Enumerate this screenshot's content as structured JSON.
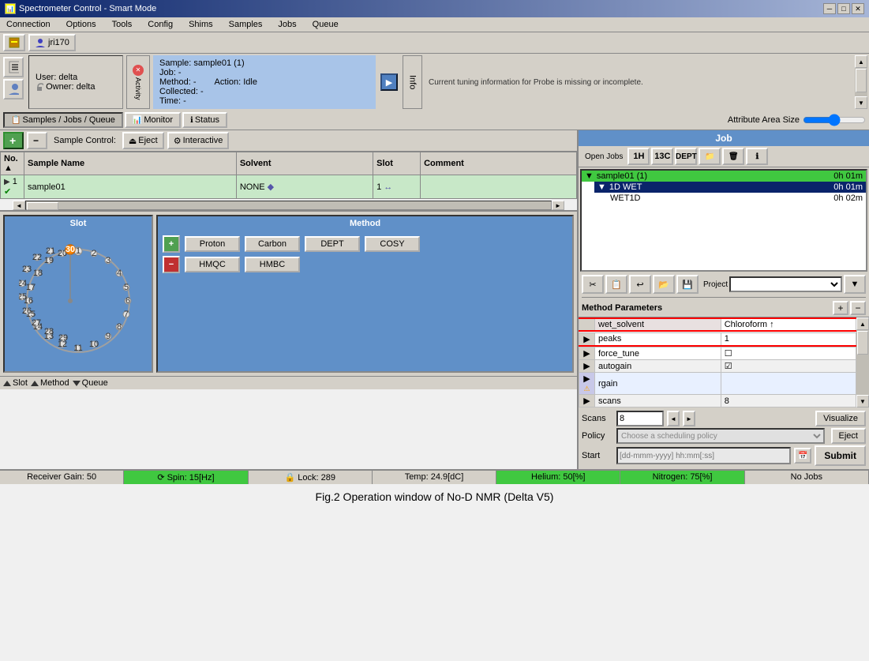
{
  "window": {
    "title": "Spectrometer Control - Smart Mode",
    "icon": "spectrum-icon"
  },
  "menu": {
    "items": [
      "Connection",
      "Options",
      "Tools",
      "Config",
      "Shims",
      "Samples",
      "Jobs",
      "Queue"
    ]
  },
  "toolbar": {
    "instrument_btn": "instrument",
    "user_tab": "jri170"
  },
  "user_info": {
    "user_label": "User:",
    "user_value": "delta",
    "owner_label": "Owner:",
    "owner_value": "delta"
  },
  "sample_info": {
    "sample_label": "Sample:",
    "sample_value": "sample01 (1)",
    "job_label": "Job:",
    "job_value": "-",
    "method_label": "Method:",
    "method_value": "-",
    "action_label": "Action:",
    "action_value": "Idle",
    "collected_label": "Collected:",
    "collected_value": "-",
    "time_label": "Time:",
    "time_value": "-"
  },
  "activity": {
    "label": "Activity"
  },
  "info": {
    "label": "Info"
  },
  "status_message": "Current tuning information for Probe is missing or incomplete.",
  "tabs": {
    "samples_jobs": "Samples / Jobs / Queue",
    "monitor": "Monitor",
    "status": "Status"
  },
  "attr_size_label": "Attribute Area Size",
  "sample_control": {
    "label": "Sample Control:",
    "eject_btn": "Eject",
    "interactive_btn": "Interactive",
    "add_btn": "+",
    "remove_btn": "-"
  },
  "table": {
    "headers": [
      "No.",
      "Sample Name",
      "Solvent",
      "Slot",
      "Comment"
    ],
    "rows": [
      {
        "no": "1",
        "name": "sample01",
        "solvent": "NONE",
        "slot": "1",
        "comment": ""
      }
    ]
  },
  "slot_panel": {
    "title": "Slot",
    "slot_number": "30"
  },
  "method_panel": {
    "title": "Method",
    "buttons_row1": [
      "Proton",
      "Carbon",
      "DEPT",
      "COSY"
    ],
    "buttons_row2": [
      "HMQC",
      "HMBC"
    ]
  },
  "job_panel": {
    "title": "Job",
    "open_jobs_label": "Open Jobs",
    "nuclei_buttons": [
      "1H",
      "13C",
      "DEPT",
      "folder",
      "delete",
      "info"
    ],
    "tree": [
      {
        "label": "sample01 (1)",
        "time": "0h 01m",
        "level": 0,
        "type": "sample"
      },
      {
        "label": "1D WET",
        "time": "0h 01m",
        "level": 1,
        "type": "selected"
      },
      {
        "label": "WET1D",
        "time": "0h 02m",
        "level": 2,
        "type": "normal"
      }
    ],
    "project_label": "Project",
    "action_buttons": [
      "scissors",
      "copy",
      "save",
      "folder-open",
      "floppy",
      "project"
    ]
  },
  "method_params": {
    "title": "Method Parameters",
    "rows": [
      {
        "arrow": "",
        "name": "wet_solvent",
        "value": "Chloroform ↑",
        "highlight": false,
        "red": false
      },
      {
        "arrow": "▶",
        "name": "peaks",
        "value": "1",
        "highlight": true,
        "red": false
      },
      {
        "arrow": "▶",
        "name": "force_tune",
        "value": "☐",
        "highlight": false,
        "red": true
      },
      {
        "arrow": "▶",
        "name": "autogain",
        "value": "☑",
        "highlight": false,
        "red": false
      },
      {
        "arrow": "▶⚠",
        "name": "rgain",
        "value": "",
        "highlight": false,
        "red": false
      },
      {
        "arrow": "▶",
        "name": "scans",
        "value": "8",
        "highlight": false,
        "red": false
      }
    ]
  },
  "bottom_controls": {
    "scans_label": "Scans",
    "scans_value": "8",
    "policy_label": "Policy",
    "policy_placeholder": "Choose a scheduling policy",
    "start_label": "Start",
    "start_placeholder": "[dd-mmm-yyyy] hh:mm[:ss]",
    "visualize_btn": "Visualize",
    "eject_btn": "Eject",
    "submit_btn": "Submit"
  },
  "bottom_tabs": {
    "slot": "Slot",
    "method": "Method",
    "queue": "Queue"
  },
  "status_bar": {
    "receiver_gain": "Receiver Gain: 50",
    "spin": "Spin: 15[Hz]",
    "lock": "Lock: 289",
    "temp": "Temp: 24.9[dC]",
    "helium": "Helium: 50[%]",
    "nitrogen": "Nitrogen: 75[%]",
    "jobs": "No Jobs"
  },
  "figure_caption": "Fig.2  Operation window of No-D NMR (Delta V5)"
}
